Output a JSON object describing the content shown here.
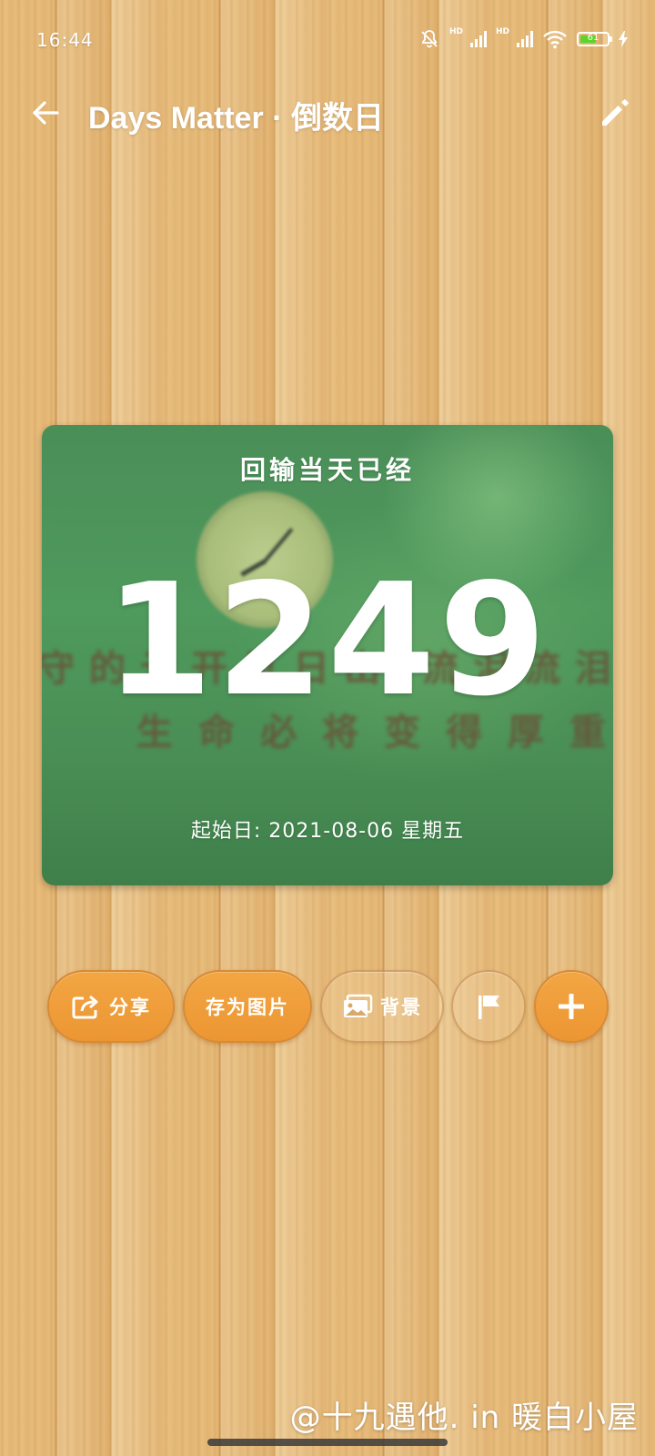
{
  "status_bar": {
    "time": "16:44",
    "network_tag_1": "HD",
    "network_tag_2": "HD",
    "battery": "61",
    "battery_level": 0.61,
    "icons": [
      "mute-bell-icon",
      "signal-icon",
      "signal-icon",
      "wifi-icon",
      "battery-icon",
      "charging-bolt-icon"
    ]
  },
  "app_bar": {
    "title": "Days Matter · 倒数日",
    "back_icon": "arrow-left-icon",
    "edit_icon": "pencil-icon"
  },
  "card": {
    "heading": "回输当天已经",
    "count": "1249",
    "start_date": "起始日: 2021-08-06 星期五",
    "background_text_line1": "守的云开见日出 流泪流泪后",
    "background_text_line2": "生命必将变得厚重!",
    "colors": {
      "base": "#4f9a5d",
      "highlight": "#9ed08c"
    }
  },
  "actions": {
    "share_label": "分享",
    "save_image_label": "存为图片",
    "background_label": "背景",
    "flag_icon": "flag-icon",
    "add_icon": "plus-icon",
    "accent_color": "#ef9d3a"
  },
  "watermark": "@十九遇他. in 暖白小屋"
}
